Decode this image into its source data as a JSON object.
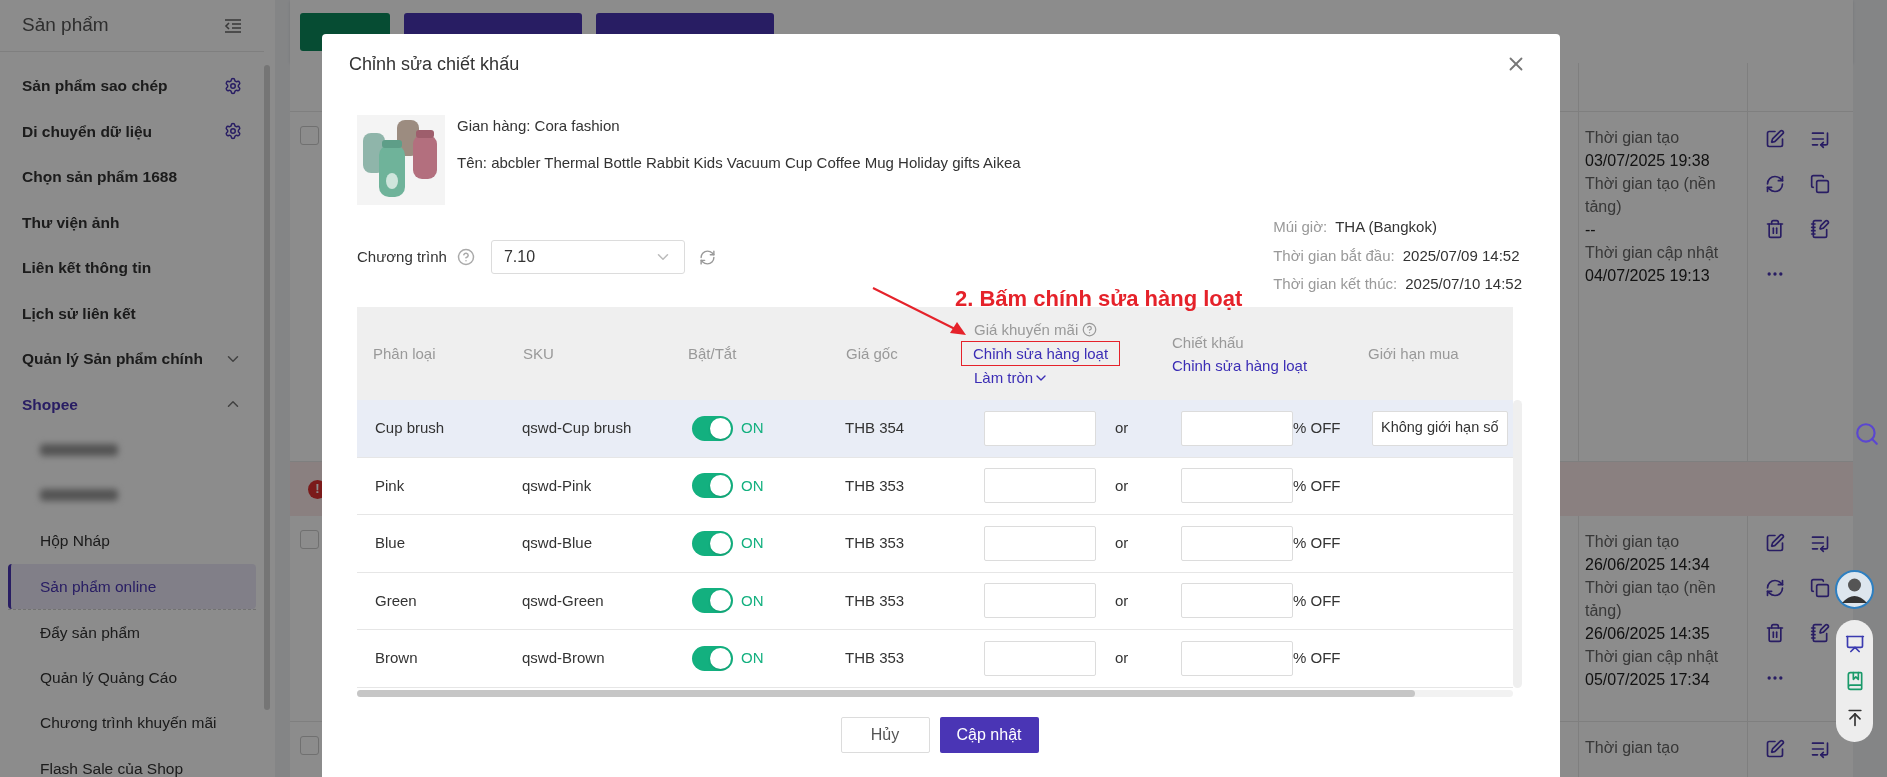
{
  "sidebar": {
    "title": "Sản phẩm",
    "items": [
      {
        "kind": "setting",
        "label": "Sản phẩm sao chép"
      },
      {
        "kind": "setting",
        "label": "Di chuyển dữ liệu"
      },
      {
        "kind": "link",
        "label": "Chọn sản phẩm 1688"
      },
      {
        "kind": "link",
        "label": "Thư viện ảnh"
      },
      {
        "kind": "link",
        "label": "Liên kết thông tin"
      },
      {
        "kind": "link",
        "label": "Lịch sử liên kết"
      },
      {
        "kind": "group",
        "label": "Quản lý Sản phẩm chính",
        "expanded": false
      },
      {
        "kind": "group",
        "label": "Shopee",
        "expanded": true,
        "children": [
          {
            "kind": "blurred",
            "selected": false
          },
          {
            "kind": "blurred",
            "selected": false
          },
          {
            "kind": "page",
            "label": "Hộp Nháp",
            "selected": false
          },
          {
            "kind": "page",
            "label": "Sản phẩm online",
            "selected": true
          },
          {
            "kind": "page",
            "label": "Đẩy sản phẩm",
            "selected": false,
            "divider_before": true
          },
          {
            "kind": "page",
            "label": "Quản lý Quảng Cáo",
            "selected": false
          },
          {
            "kind": "page",
            "label": "Chương trình khuyến mãi",
            "selected": false
          },
          {
            "kind": "page",
            "label": "Flash Sale của Shop",
            "selected": false
          }
        ]
      }
    ]
  },
  "toolbar": [
    {
      "kind": "success"
    },
    {
      "kind": "primary"
    },
    {
      "kind": "primary"
    }
  ],
  "products": [
    {
      "kind": "product",
      "checked": false,
      "times": [
        {
          "label": "Thời gian tạo",
          "value": "03/07/2025 19:38"
        },
        {
          "label": "Thời gian tạo (nền tảng)",
          "value": "--"
        },
        {
          "label": "Thời gian cập nhật",
          "value": "04/07/2025 19:13"
        }
      ]
    },
    {
      "kind": "error",
      "badge": "!"
    },
    {
      "kind": "product",
      "checked": false,
      "times": [
        {
          "label": "Thời gian tạo",
          "value": "26/06/2025 14:34"
        },
        {
          "label": "Thời gian tạo (nền tảng)",
          "value": "26/06/2025 14:35"
        },
        {
          "label": "Thời gian cập nhật",
          "value": "05/07/2025 17:34"
        }
      ]
    },
    {
      "kind": "product",
      "checked": false,
      "times": [
        {
          "label": "Thời gian tạo"
        }
      ]
    }
  ],
  "dialog": {
    "title": "Chỉnh sửa chiết khấu",
    "shop": "Gian hàng: Cora fashion",
    "name": "Tên: abcbler Thermal Bottle Rabbit Kids Vacuum Cup Coffee Mug Holiday gifts Aikea",
    "program": {
      "label": "Chương trình",
      "value": "7.10"
    },
    "meta": [
      {
        "label": "Múi giờ:",
        "value": "THA (Bangkok)"
      },
      {
        "label": "Thời gian bắt đầu:",
        "value": "2025/07/09 14:52"
      },
      {
        "label": "Thời gian kết thúc:",
        "value": "2025/07/10 14:52"
      }
    ],
    "annotation": {
      "text": "2. Bấm chính sửa hàng loạt",
      "boxed": true
    },
    "table": {
      "columns": [
        {
          "label": "Phân loại"
        },
        {
          "label": "SKU"
        },
        {
          "label": "Bật/Tắt"
        },
        {
          "label": "Giá gốc"
        },
        {
          "label": "Giá khuyến mãi",
          "help": true,
          "batch_edit": "Chỉnh sửa hàng loạt",
          "rounding": "Làm tròn"
        },
        {
          "label": "Chiết khấu",
          "batch_edit": "Chỉnh sửa hàng loạt"
        },
        {
          "label": "Giới hạn mua"
        }
      ],
      "rows": [
        {
          "variant": "Cup brush",
          "sku": "qswd-Cup brush",
          "on": true,
          "status": "ON",
          "price": "THB 354",
          "or": "or",
          "off": "% OFF",
          "limit": "Không giới hạn số",
          "highlighted": true
        },
        {
          "variant": "Pink",
          "sku": "qswd-Pink",
          "on": true,
          "status": "ON",
          "price": "THB 353",
          "or": "or",
          "off": "% OFF",
          "highlighted": false
        },
        {
          "variant": "Blue",
          "sku": "qswd-Blue",
          "on": true,
          "status": "ON",
          "price": "THB 353",
          "or": "or",
          "off": "% OFF",
          "highlighted": false
        },
        {
          "variant": "Green",
          "sku": "qswd-Green",
          "on": true,
          "status": "ON",
          "price": "THB 353",
          "or": "or",
          "off": "% OFF",
          "highlighted": false
        },
        {
          "variant": "Brown",
          "sku": "qswd-Brown",
          "on": true,
          "status": "ON",
          "price": "THB 353",
          "or": "or",
          "off": "% OFF",
          "highlighted": false
        }
      ]
    },
    "buttons": [
      {
        "kind": "secondary",
        "label": "Hủy"
      },
      {
        "kind": "primary",
        "label": "Cập nhật"
      }
    ]
  }
}
